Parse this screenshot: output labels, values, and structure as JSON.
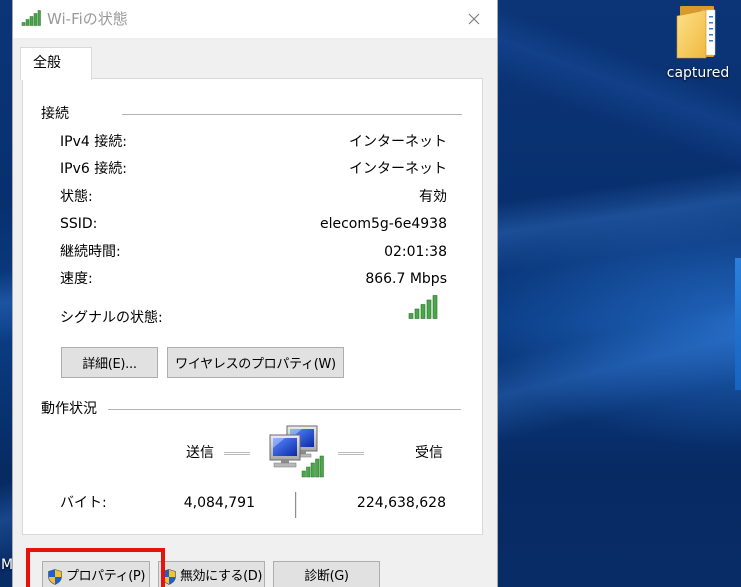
{
  "window": {
    "title": "Wi-Fiの状態"
  },
  "tabs": [
    {
      "label": "全般",
      "selected": true
    }
  ],
  "connection": {
    "heading": "接続",
    "rows": [
      {
        "label": "IPv4 接続:",
        "value": "インターネット"
      },
      {
        "label": "IPv6 接続:",
        "value": "インターネット"
      },
      {
        "label": "状態:",
        "value": "有効"
      },
      {
        "label": "SSID:",
        "value": "elecom5g-6e4938"
      },
      {
        "label": "継続時間:",
        "value": "02:01:38"
      },
      {
        "label": "速度:",
        "value": "866.7 Mbps"
      }
    ],
    "signal_label": "シグナルの状態:",
    "signal_bars": 5,
    "signal_level": 5,
    "details_button": "詳細(E)...",
    "wireless_properties_button": "ワイヤレスのプロパティ(W)"
  },
  "activity": {
    "heading": "動作状況",
    "sent_label": "送信",
    "received_label": "受信",
    "bytes_label": "バイト:",
    "bytes_sent": "4,084,791",
    "bytes_received": "224,638,628"
  },
  "footer": {
    "properties_button": "プロパティ(P)",
    "disable_button": "無効にする(D)",
    "diagnose_button": "診断(G)"
  },
  "desktop": {
    "folder_label": "captured",
    "partial_label": "M"
  },
  "colors": {
    "desktop": "#072a63",
    "dialog_bg": "#f0f0f0",
    "title_text": "#9a9a9a",
    "signal_green": "#4aa84a",
    "signal_outline": "#2e6b2e",
    "highlight_red": "#e8120c"
  },
  "icons": {
    "title": "wifi-signal-icon",
    "close": "close-icon",
    "signal": "signal-strength-icon",
    "network": "network-computers-icon",
    "shield": "uac-shield-icon",
    "folder": "folder-icon"
  }
}
